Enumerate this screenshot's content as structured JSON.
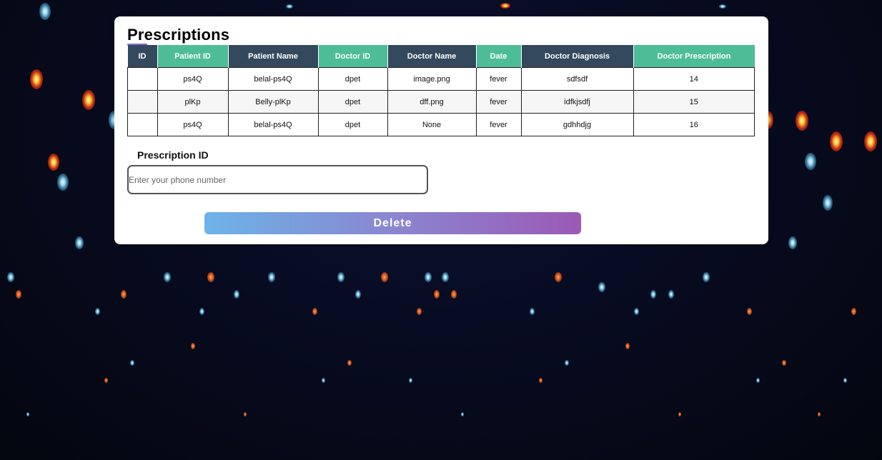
{
  "page": {
    "title": "Prescriptions"
  },
  "table": {
    "headers": [
      {
        "label": "ID",
        "style": "dark"
      },
      {
        "label": "Patient ID",
        "style": "teal"
      },
      {
        "label": "Patient Name",
        "style": "dark"
      },
      {
        "label": "Doctor ID",
        "style": "teal"
      },
      {
        "label": "Doctor Name",
        "style": "dark"
      },
      {
        "label": "Date",
        "style": "teal"
      },
      {
        "label": "Doctor Diagnosis",
        "style": "dark"
      },
      {
        "label": "Doctor Prescription",
        "style": "teal"
      }
    ],
    "rows": [
      [
        "",
        "ps4Q",
        "belal-ps4Q",
        "dpet",
        "image.png",
        "fever",
        "sdfsdf",
        "14"
      ],
      [
        "",
        "plKp",
        "Belly-plKp",
        "dpet",
        "dff.png",
        "fever",
        "idfkjsdfj",
        "15"
      ],
      [
        "",
        "ps4Q",
        "belal-ps4Q",
        "dpet",
        "None",
        "fever",
        "gdhhdjg",
        "16"
      ]
    ]
  },
  "form": {
    "label": "Prescription ID",
    "placeholder": "Enter your phone number",
    "value": "",
    "delete_label": "Delete"
  },
  "colors": {
    "header_dark": "#34495e",
    "header_teal": "#4dbd98",
    "button_gradient_start": "#6db3e8",
    "button_gradient_end": "#9b59b6",
    "background": "#070a1c"
  }
}
